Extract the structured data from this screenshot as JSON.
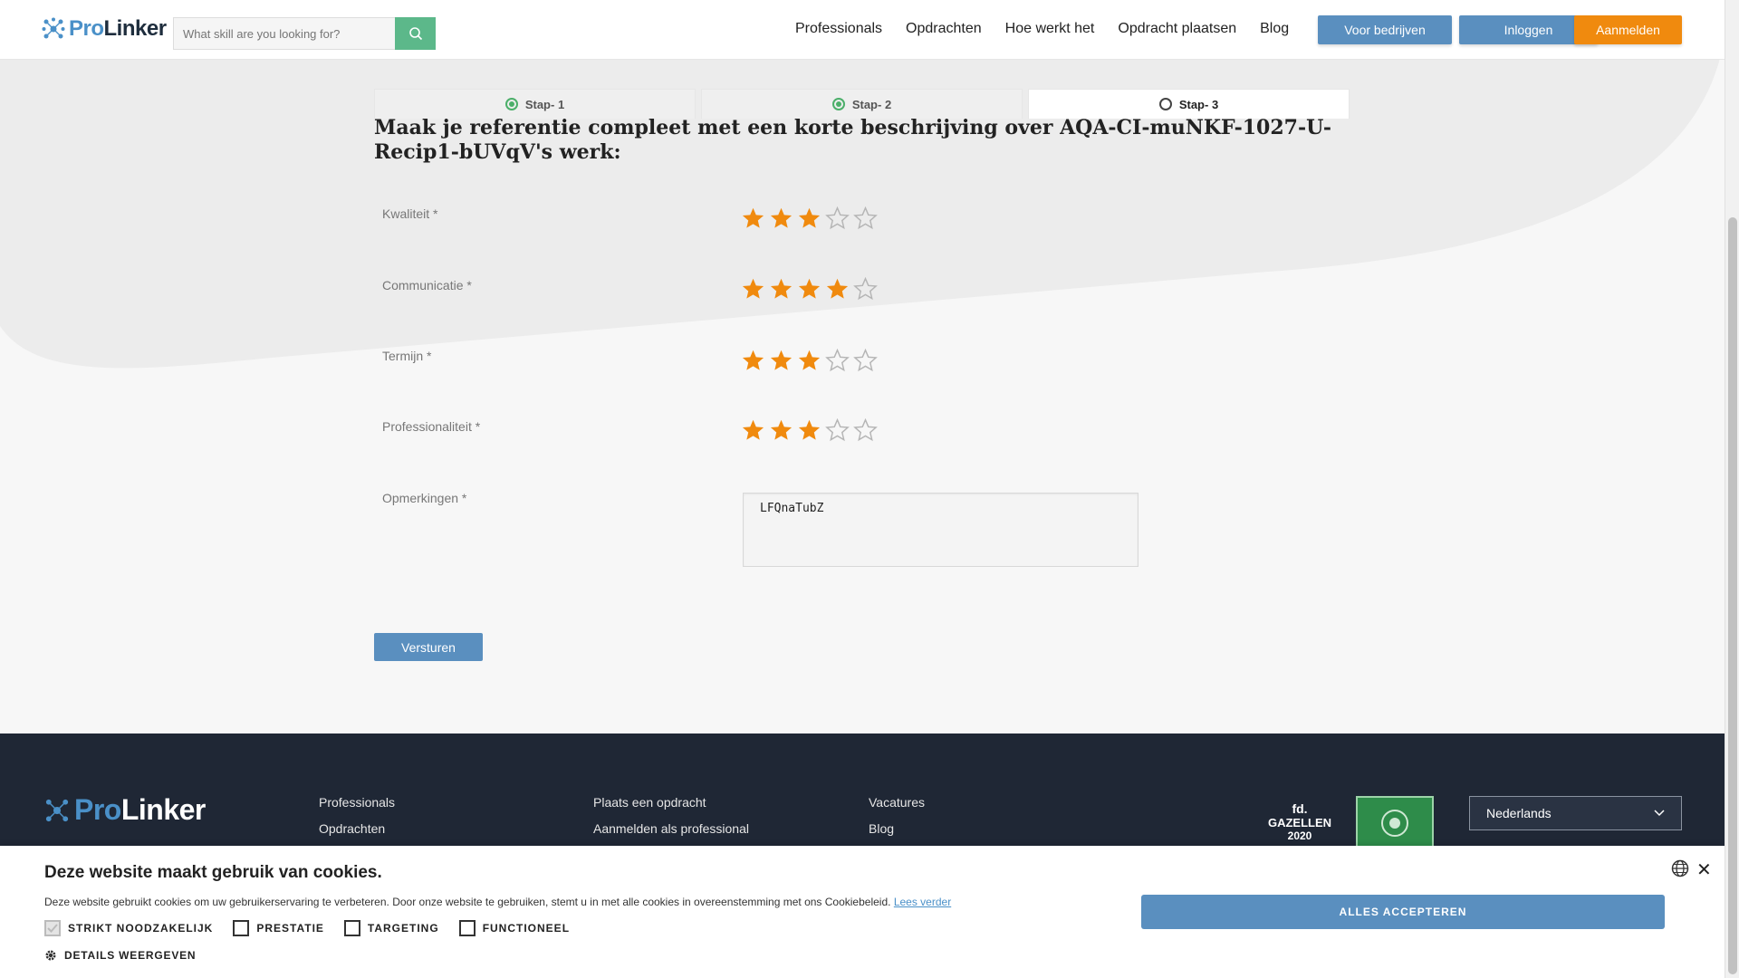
{
  "header": {
    "logo_pro": "Pro",
    "logo_linker": "Linker",
    "search_placeholder": "What skill are you looking for?",
    "nav": [
      "Professionals",
      "Opdrachten",
      "Hoe werkt het",
      "Opdracht plaatsen",
      "Blog"
    ],
    "btn_bedrijven": "Voor bedrijven",
    "btn_inloggen": "Inloggen",
    "btn_aanmelden": "Aanmelden"
  },
  "steps": [
    {
      "label": "Stap- 1",
      "done": true
    },
    {
      "label": "Stap- 2",
      "done": true
    },
    {
      "label": "Stap- 3",
      "done": false
    }
  ],
  "form": {
    "title": "Maak je referentie compleet met een korte beschrijving over AQA-CI-muNKF-1027-U-Recip1-bUVqV's werk:",
    "ratings": [
      {
        "label": "Kwaliteit *",
        "value": 3,
        "max": 5
      },
      {
        "label": "Communicatie *",
        "value": 4,
        "max": 5
      },
      {
        "label": "Termijn *",
        "value": 3,
        "max": 5
      },
      {
        "label": "Professionaliteit *",
        "value": 3,
        "max": 5
      }
    ],
    "remarks_label": "Opmerkingen *",
    "remarks_value": "LFQnaTubZ",
    "submit": "Versturen"
  },
  "footer": {
    "col1": [
      "Professionals",
      "Opdrachten"
    ],
    "col2": [
      "Plaats een opdracht",
      "Aanmelden als professional"
    ],
    "col3": [
      "Vacatures",
      "Blog"
    ],
    "badge_fd_line1": "fd.",
    "badge_fd_line2": "GAZELLEN",
    "badge_fd_line3": "2020",
    "language": "Nederlands"
  },
  "cookie": {
    "title": "Deze website maakt gebruik van cookies.",
    "text": "Deze website gebruikt cookies om uw gebruikerservaring te verbeteren. Door onze website te gebruiken, stemt u in met alle cookies in overeenstemming met ons Cookiebeleid.",
    "link": "Lees verder",
    "options": [
      {
        "label": "STRIKT NOODZAKELIJK",
        "checked": true
      },
      {
        "label": "PRESTATIE",
        "checked": false
      },
      {
        "label": "TARGETING",
        "checked": false
      },
      {
        "label": "FUNCTIONEEL",
        "checked": false
      }
    ],
    "details": "DETAILS WEERGEVEN",
    "accept": "ALLES ACCEPTEREN"
  },
  "colors": {
    "accent_blue": "#5a8fbf",
    "accent_orange": "#f08a0e",
    "star_fill": "#f08a0e",
    "footer_bg": "#1f2735"
  }
}
